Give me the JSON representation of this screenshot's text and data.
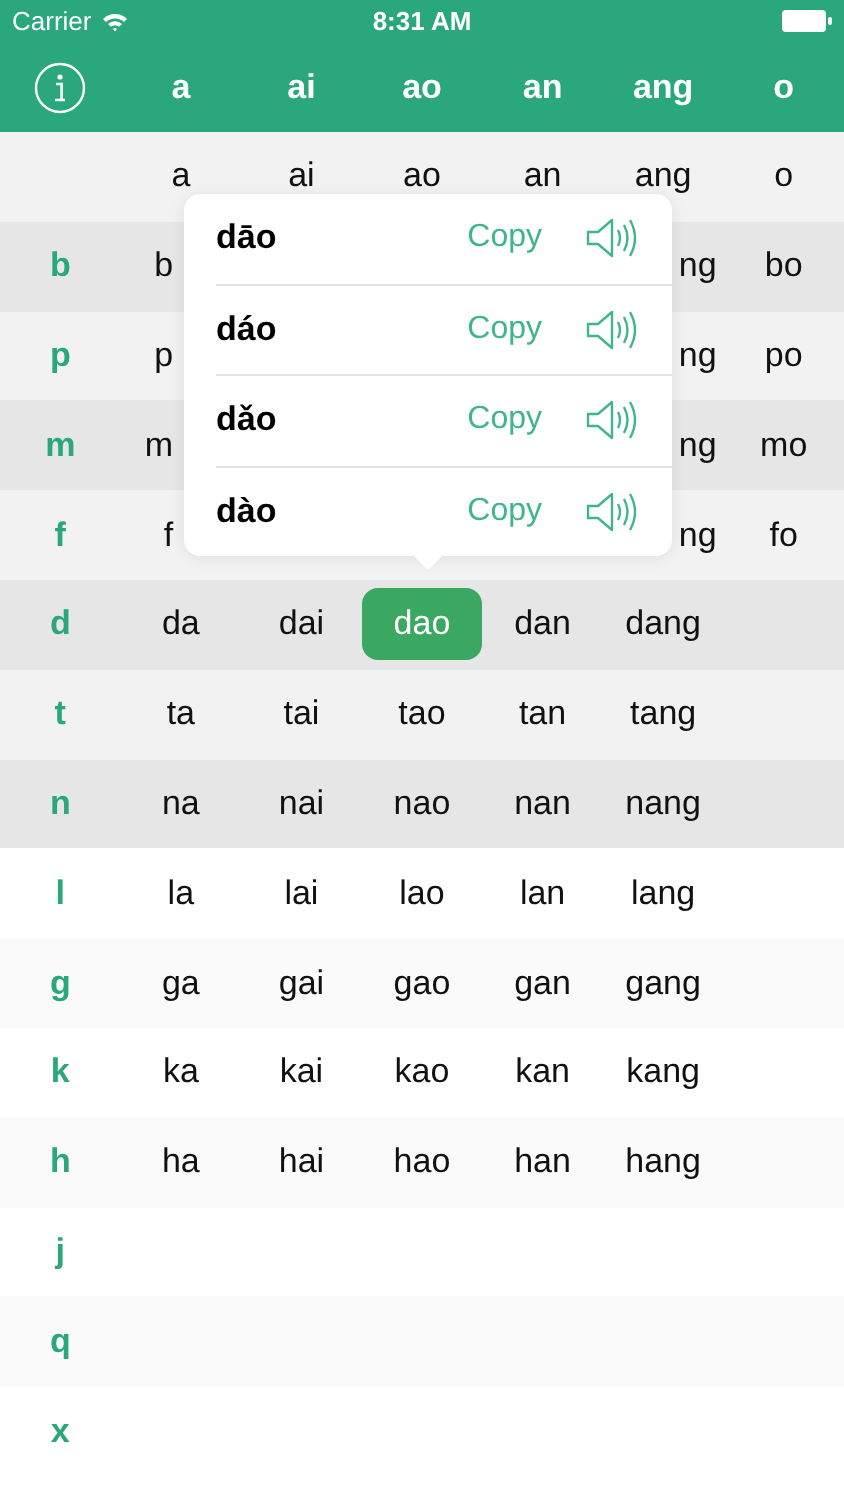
{
  "status_bar": {
    "carrier": "Carrier",
    "time": "8:31 AM"
  },
  "header": {
    "finals": [
      "a",
      "ai",
      "ao",
      "an",
      "ang",
      "o"
    ]
  },
  "rows": [
    {
      "initial": null,
      "cells": [
        {
          "text": "a",
          "selected": false
        },
        {
          "text": "ai",
          "selected": false
        },
        {
          "text": "ao",
          "selected": false
        },
        {
          "text": "an",
          "selected": false
        },
        {
          "text": "ang",
          "selected": false
        },
        {
          "text": "o",
          "selected": false
        }
      ]
    },
    {
      "initial": "b",
      "cells": [
        {
          "text": "b",
          "selected": false
        },
        null,
        null,
        null,
        {
          "text": "ng",
          "selected": false
        },
        {
          "text": "bo",
          "selected": false
        }
      ]
    },
    {
      "initial": "p",
      "cells": [
        {
          "text": "p",
          "selected": false
        },
        null,
        null,
        null,
        {
          "text": "ng",
          "selected": false
        },
        {
          "text": "po",
          "selected": false
        }
      ]
    },
    {
      "initial": "m",
      "cells": [
        {
          "text": "m",
          "selected": false
        },
        null,
        null,
        null,
        {
          "text": "ng",
          "selected": false
        },
        {
          "text": "mo",
          "selected": false
        }
      ]
    },
    {
      "initial": "f",
      "cells": [
        {
          "text": "f",
          "selected": false
        },
        null,
        null,
        null,
        {
          "text": "ng",
          "selected": false
        },
        {
          "text": "fo",
          "selected": false
        }
      ]
    },
    {
      "initial": "d",
      "cells": [
        {
          "text": "da",
          "selected": false
        },
        {
          "text": "dai",
          "selected": false
        },
        {
          "text": "dao",
          "selected": true
        },
        {
          "text": "dan",
          "selected": false
        },
        {
          "text": "dang",
          "selected": false
        },
        null
      ]
    },
    {
      "initial": "t",
      "cells": [
        {
          "text": "ta",
          "selected": false
        },
        {
          "text": "tai",
          "selected": false
        },
        {
          "text": "tao",
          "selected": false
        },
        {
          "text": "tan",
          "selected": false
        },
        {
          "text": "tang",
          "selected": false
        },
        null
      ]
    },
    {
      "initial": "n",
      "cells": [
        {
          "text": "na",
          "selected": false
        },
        {
          "text": "nai",
          "selected": false
        },
        {
          "text": "nao",
          "selected": false
        },
        {
          "text": "nan",
          "selected": false
        },
        {
          "text": "nang",
          "selected": false
        },
        null
      ]
    },
    {
      "initial": "l",
      "cells": [
        {
          "text": "la",
          "selected": false
        },
        {
          "text": "lai",
          "selected": false
        },
        {
          "text": "lao",
          "selected": false
        },
        {
          "text": "lan",
          "selected": false
        },
        {
          "text": "lang",
          "selected": false
        },
        null
      ]
    },
    {
      "initial": "g",
      "cells": [
        {
          "text": "ga",
          "selected": false
        },
        {
          "text": "gai",
          "selected": false
        },
        {
          "text": "gao",
          "selected": false
        },
        {
          "text": "gan",
          "selected": false
        },
        {
          "text": "gang",
          "selected": false
        },
        null
      ]
    },
    {
      "initial": "k",
      "cells": [
        {
          "text": "ka",
          "selected": false
        },
        {
          "text": "kai",
          "selected": false
        },
        {
          "text": "kao",
          "selected": false
        },
        {
          "text": "kan",
          "selected": false
        },
        {
          "text": "kang",
          "selected": false
        },
        null
      ]
    },
    {
      "initial": "h",
      "cells": [
        {
          "text": "ha",
          "selected": false
        },
        {
          "text": "hai",
          "selected": false
        },
        {
          "text": "hao",
          "selected": false
        },
        {
          "text": "han",
          "selected": false
        },
        {
          "text": "hang",
          "selected": false
        },
        null
      ]
    },
    {
      "initial": "j",
      "cells": [
        null,
        null,
        null,
        null,
        null,
        null
      ]
    },
    {
      "initial": "q",
      "cells": [
        null,
        null,
        null,
        null,
        null,
        null
      ]
    },
    {
      "initial": "x",
      "cells": [
        null,
        null,
        null,
        null,
        null,
        null
      ]
    }
  ],
  "popup": {
    "items": [
      {
        "syllable": "dāo",
        "action": "Copy"
      },
      {
        "syllable": "dáo",
        "action": "Copy"
      },
      {
        "syllable": "dǎo",
        "action": "Copy"
      },
      {
        "syllable": "dào",
        "action": "Copy"
      }
    ]
  }
}
